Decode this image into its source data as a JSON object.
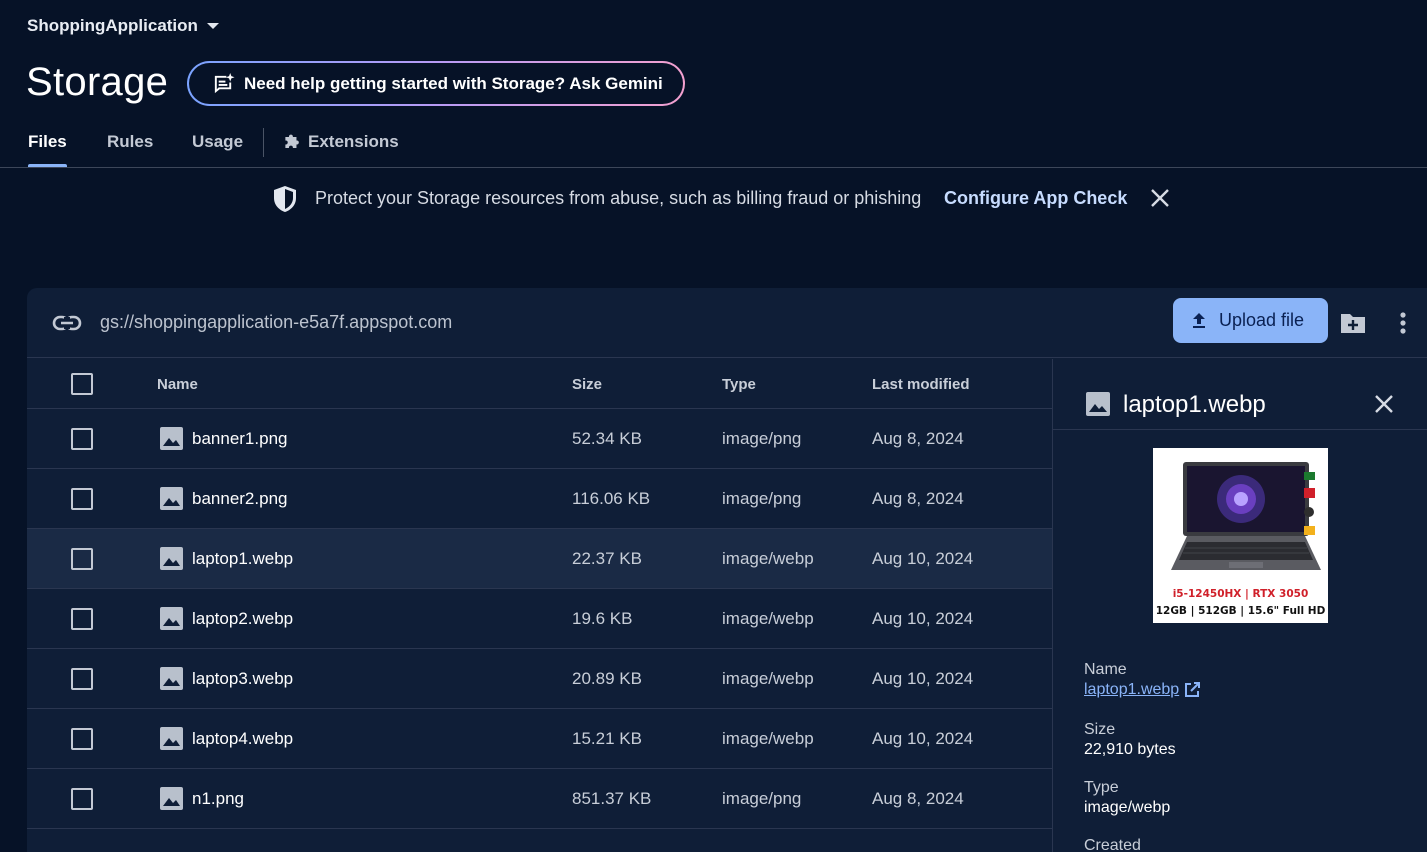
{
  "header": {
    "project_name": "ShoppingApplication",
    "page_title": "Storage",
    "gemini_prompt": "Need help getting started with Storage? Ask Gemini"
  },
  "tabs": [
    {
      "label": "Files",
      "active": true
    },
    {
      "label": "Rules",
      "active": false
    },
    {
      "label": "Usage",
      "active": false
    },
    {
      "label": "Extensions",
      "active": false
    }
  ],
  "banner": {
    "message": "Protect your Storage resources from abuse, such as billing fraud or phishing",
    "action": "Configure App Check"
  },
  "toolbar": {
    "bucket_path": "gs://shoppingapplication-e5a7f.appspot.com",
    "upload_label": "Upload file"
  },
  "table": {
    "headers": {
      "name": "Name",
      "size": "Size",
      "type": "Type",
      "modified": "Last modified"
    },
    "rows": [
      {
        "name": "banner1.png",
        "size": "52.34 KB",
        "type": "image/png",
        "modified": "Aug 8, 2024"
      },
      {
        "name": "banner2.png",
        "size": "116.06 KB",
        "type": "image/png",
        "modified": "Aug 8, 2024"
      },
      {
        "name": "laptop1.webp",
        "size": "22.37 KB",
        "type": "image/webp",
        "modified": "Aug 10, 2024"
      },
      {
        "name": "laptop2.webp",
        "size": "19.6 KB",
        "type": "image/webp",
        "modified": "Aug 10, 2024"
      },
      {
        "name": "laptop3.webp",
        "size": "20.89 KB",
        "type": "image/webp",
        "modified": "Aug 10, 2024"
      },
      {
        "name": "laptop4.webp",
        "size": "15.21 KB",
        "type": "image/webp",
        "modified": "Aug 10, 2024"
      },
      {
        "name": "n1.png",
        "size": "851.37 KB",
        "type": "image/png",
        "modified": "Aug 8, 2024"
      }
    ]
  },
  "details": {
    "title": "laptop1.webp",
    "preview_text": {
      "line1": "i5-12450HX | RTX 3050",
      "line2": "12GB | 512GB | 15.6\" Full HD"
    },
    "name_label": "Name",
    "name_value": "laptop1.webp",
    "size_label": "Size",
    "size_value": "22,910 bytes",
    "type_label": "Type",
    "type_value": "image/webp",
    "created_label": "Created"
  },
  "colors": {
    "accent": "#8ab4f8",
    "background": "#061227",
    "panel": "#0f1e37"
  }
}
